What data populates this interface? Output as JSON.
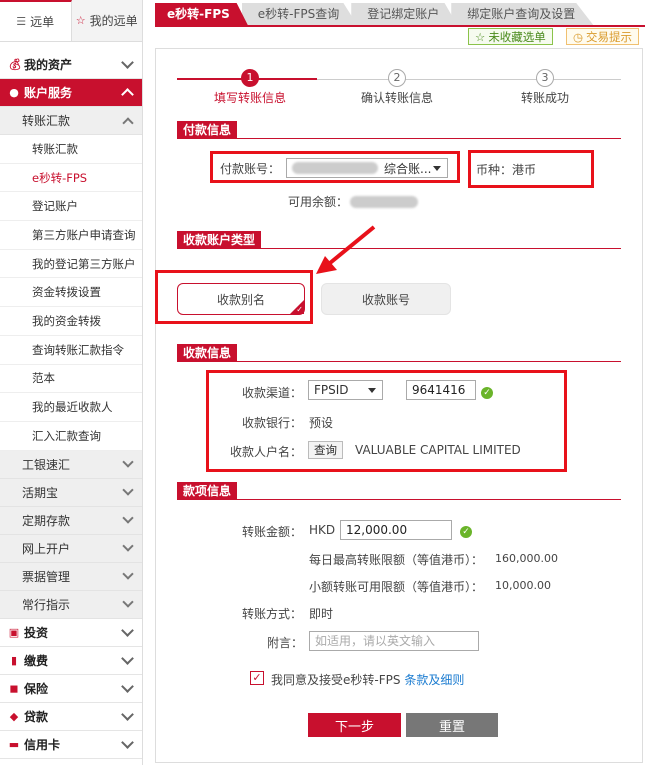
{
  "sidebar": {
    "tabs": [
      {
        "label": "远单",
        "icon": "list-icon"
      },
      {
        "label": "我的远单",
        "icon": "star-icon"
      }
    ],
    "menu": {
      "my_assets": "我的资产",
      "account_services": "账户服务",
      "transfer": "转账汇款",
      "leaves": [
        "转账汇款",
        "e秒转-FPS",
        "登记账户",
        "第三方账户申请查询",
        "我的登记第三方账户",
        "资金转拨设置",
        "我的资金转拨",
        "查询转账汇款指令",
        "范本",
        "我的最近收款人",
        "汇入汇款查询"
      ],
      "current_leaf": "e秒转-FPS",
      "subs": [
        "工银速汇",
        "活期宝",
        "定期存款",
        "网上开户",
        "票据管理",
        "常行指示"
      ],
      "bottom": [
        {
          "label": "投资",
          "icon": "invest-icon"
        },
        {
          "label": "缴费",
          "icon": "chart-icon"
        },
        {
          "label": "保险",
          "icon": "lock-icon"
        },
        {
          "label": "贷款",
          "icon": "diamond-icon"
        },
        {
          "label": "信用卡",
          "icon": "card-icon"
        }
      ]
    }
  },
  "top_tabs": [
    "e秒转-FPS",
    "e秒转-FPS查询",
    "登记绑定账户",
    "绑定账户查询及设置"
  ],
  "favorite_label": "未收藏选单",
  "tip_label": "交易提示",
  "steps": [
    {
      "num": "1",
      "label": "填写转账信息"
    },
    {
      "num": "2",
      "label": "确认转账信息"
    },
    {
      "num": "3",
      "label": "转账成功"
    }
  ],
  "payment": {
    "section": "付款信息",
    "account_label": "付款账号：",
    "account_value": "综合账...",
    "currency_label": "币种：港币",
    "balance_label": "可用余额："
  },
  "payee_type": {
    "section": "收款账户类型",
    "alias": "收款别名",
    "account": "收款账号"
  },
  "payee": {
    "section": "收款信息",
    "channel_label": "收款渠道：",
    "channel_value": "FPSID",
    "fps_id": "9641416",
    "bank_label": "收款银行：",
    "bank_value": "预设",
    "name_label": "收款人户名：",
    "query_button": "查询",
    "name_value": "VALUABLE CAPITAL LIMITED"
  },
  "amount": {
    "section": "款项信息",
    "amount_label": "转账金额：",
    "currency": "HKD",
    "amount_value": "12,000.00",
    "daily_limit_label": "每日最高转账限额（等值港币）：",
    "daily_limit_value": "160,000.00",
    "small_limit_label": "小额转账可用限额（等值港币）：",
    "small_limit_value": "10,000.00",
    "method_label": "转账方式：",
    "method_value": "即时",
    "remark_label": "附言：",
    "remark_placeholder": "如适用，请以英文输入"
  },
  "agree": {
    "text": "我同意及接受e秒转-FPS",
    "link": "条款及细则"
  },
  "buttons": {
    "next": "下一步",
    "reset": "重置"
  },
  "colors": {
    "brand": "#c8102e",
    "highlight": "#e8111a",
    "ok": "#6ab42a",
    "link": "#1a7bd0"
  }
}
